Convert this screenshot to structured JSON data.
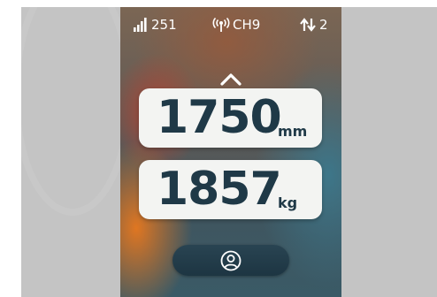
{
  "status_bar": {
    "signal_value": "251",
    "channel_label": "CH9",
    "links_count": "2"
  },
  "measurements": {
    "height": {
      "value": "1750",
      "unit": "mm"
    },
    "weight": {
      "value": "1857",
      "unit": "kg"
    }
  },
  "icons": {
    "signal": "signal-bars-icon",
    "channel": "radio-waves-icon",
    "links": "up-down-arrows-icon",
    "scroll_up": "chevron-up-icon",
    "profile": "user-icon"
  },
  "colors": {
    "card_background": "#f3f4f2",
    "value_text": "#1f3947",
    "button_background": "#254050",
    "status_text": "#ffffff"
  }
}
